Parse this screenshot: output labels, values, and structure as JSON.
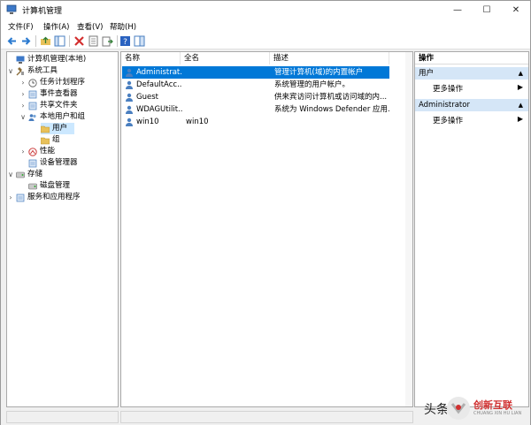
{
  "window": {
    "title": "计算机管理"
  },
  "controls": {
    "minimize": "—",
    "maximize": "☐",
    "close": "✕"
  },
  "menu": [
    "文件(F)",
    "操作(A)",
    "查看(V)",
    "帮助(H)"
  ],
  "tree": [
    {
      "label": "计算机管理(本地)",
      "expander": "",
      "icon": "computer-management-icon"
    },
    {
      "label": "系统工具",
      "expander": "∨",
      "icon": "tools-icon"
    },
    {
      "label": "任务计划程序",
      "expander": "›",
      "icon": "clock-icon"
    },
    {
      "label": "事件查看器",
      "expander": "›",
      "icon": "event-viewer-icon"
    },
    {
      "label": "共享文件夹",
      "expander": "›",
      "icon": "shared-folder-icon"
    },
    {
      "label": "本地用户和组",
      "expander": "∨",
      "icon": "users-group-icon"
    },
    {
      "label": "用户",
      "expander": "",
      "icon": "folder-icon"
    },
    {
      "label": "组",
      "expander": "",
      "icon": "folder-icon"
    },
    {
      "label": "性能",
      "expander": "›",
      "icon": "performance-icon"
    },
    {
      "label": "设备管理器",
      "expander": "",
      "icon": "device-manager-icon"
    },
    {
      "label": "存储",
      "expander": "∨",
      "icon": "storage-icon"
    },
    {
      "label": "磁盘管理",
      "expander": "",
      "icon": "disk-management-icon"
    },
    {
      "label": "服务和应用程序",
      "expander": "›",
      "icon": "services-icon"
    }
  ],
  "list": {
    "headers": [
      "名称",
      "全名",
      "描述"
    ],
    "rows": [
      {
        "name": "Administrat...",
        "fullname": "",
        "desc": "管理计算机(域)的内置帐户"
      },
      {
        "name": "DefaultAcc...",
        "fullname": "",
        "desc": "系统管理的用户帐户。"
      },
      {
        "name": "Guest",
        "fullname": "",
        "desc": "供来宾访问计算机或访问域的内..."
      },
      {
        "name": "WDAGUtilit...",
        "fullname": "",
        "desc": "系统为 Windows Defender 应用..."
      },
      {
        "name": "win10",
        "fullname": "win10",
        "desc": ""
      }
    ]
  },
  "actions": {
    "title": "操作",
    "sections": [
      {
        "label": "用户",
        "item": "更多操作"
      },
      {
        "label": "Administrator",
        "item": "更多操作"
      }
    ],
    "collapse_arrow": "▲",
    "item_arrow": "▶"
  },
  "watermark": {
    "text": "头条",
    "brand": "创新互联",
    "sub": "CHUANG XIN HU LIAN"
  },
  "colors": {
    "selection": "#0078d7",
    "section_bg": "#d5e6f7"
  }
}
